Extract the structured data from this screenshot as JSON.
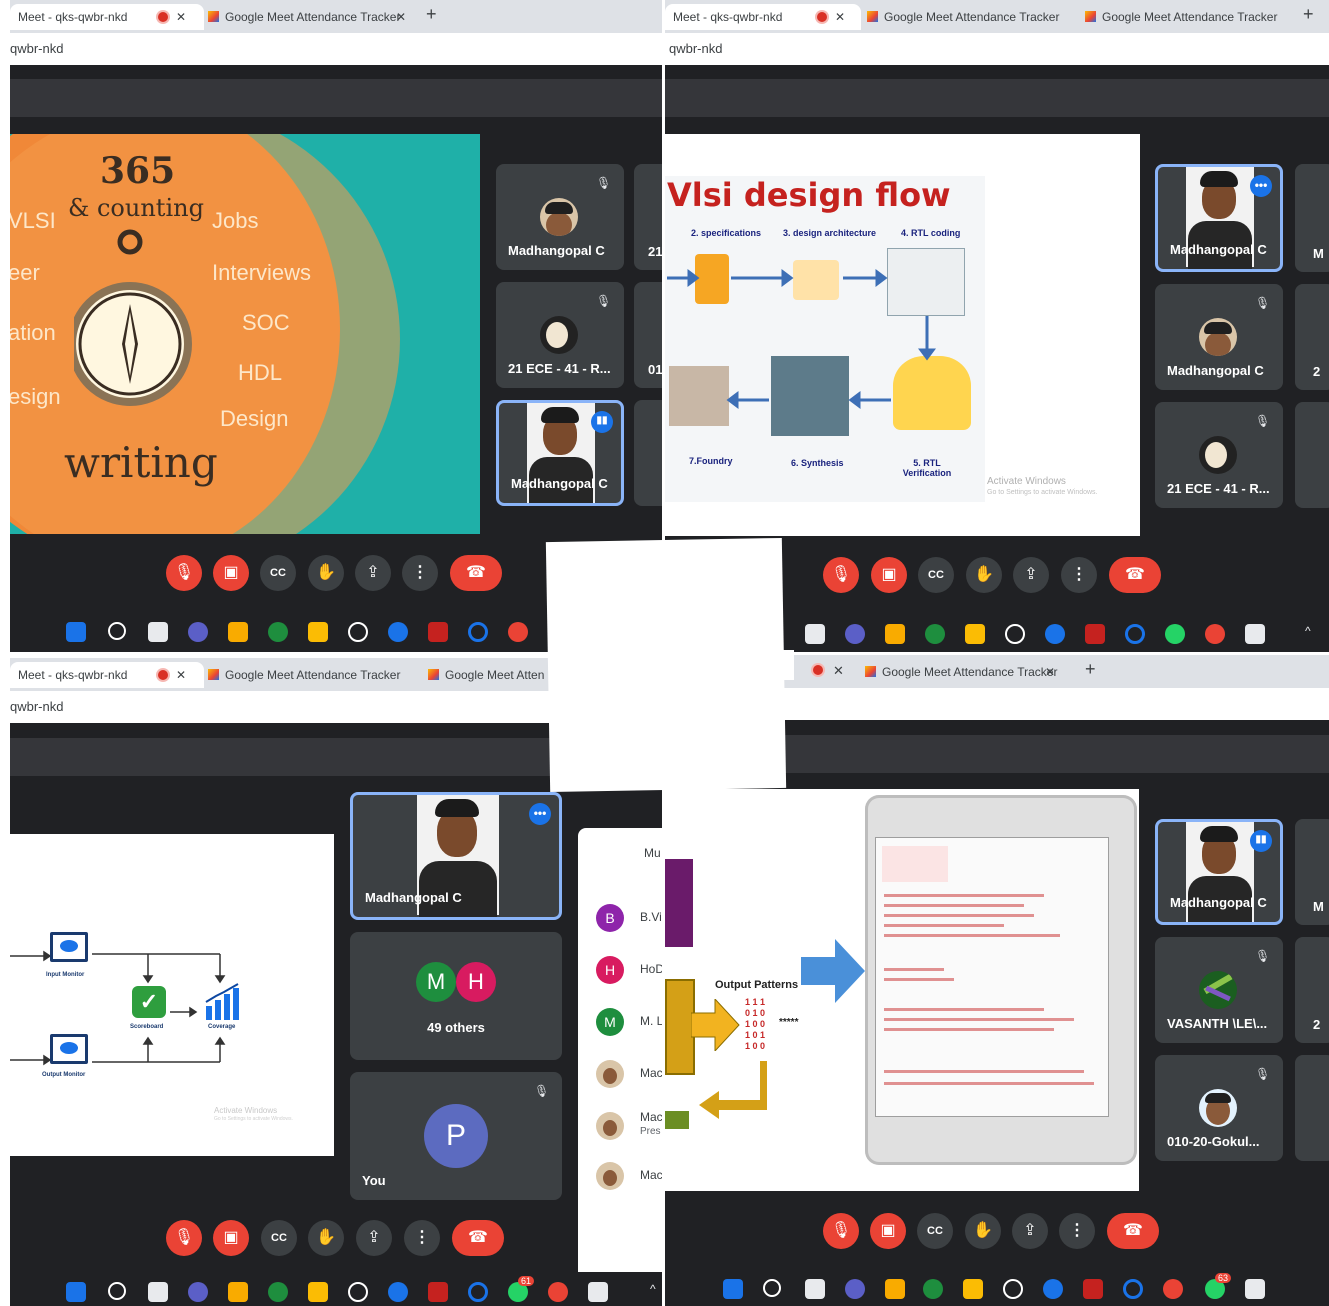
{
  "tabs": {
    "meet_tab": "Meet - qks-qwbr-nkd",
    "attendance_tab": "Google Meet Attendance Tracker",
    "attendance_tab_short": "Google Meet Atten",
    "close": "✕",
    "new_tab": "+"
  },
  "address": "qwbr-nkd",
  "q1": {
    "slide": {
      "number": "365",
      "counting": "& counting",
      "left_words": [
        "VLSI",
        "eer",
        "ation",
        "esign"
      ],
      "right_words": [
        "Jobs",
        "Interviews",
        "SOC",
        "HDL",
        "Design"
      ],
      "bottom": "writing"
    },
    "tiles": [
      {
        "name": "Madhangopal C"
      },
      {
        "name": "21 ECE - 41 - R..."
      },
      {
        "name": "Madhangopal C"
      }
    ],
    "edge_labels": [
      "21",
      "01"
    ]
  },
  "q2": {
    "slide": {
      "title": "Vlsi design flow",
      "steps": [
        "2. specifications",
        "3. design architecture",
        "4. RTL coding",
        "7.Foundry",
        "6. Synthesis",
        "5. RTL Verification"
      ],
      "watermark_title": "Activate Windows",
      "watermark_sub": "Go to Settings to activate Windows."
    },
    "tiles": [
      {
        "name": "Madhangopal C"
      },
      {
        "name": "Madhangopal C"
      },
      {
        "name": "21 ECE - 41 - R..."
      }
    ],
    "edge_labels": [
      "M",
      "2"
    ]
  },
  "q3": {
    "slide": {
      "input_monitor": "Input Monitor",
      "output_monitor": "Output Monitor",
      "scoreboard": "Scoreboard",
      "coverage": "Coverage",
      "watermark_title": "Activate Windows",
      "watermark_sub": "Go to Settings to activate Windows."
    },
    "tiles": [
      {
        "name": "Madhangopal C"
      },
      {
        "name": "49 others",
        "initials": [
          "M",
          "H"
        ]
      },
      {
        "name": "You",
        "initial": "P"
      }
    ],
    "people": [
      {
        "initial": "",
        "label": "Mu"
      },
      {
        "initial": "B",
        "label": "B.Vi",
        "color": "#8e24aa"
      },
      {
        "initial": "H",
        "label": "HoD",
        "color": "#d81b60"
      },
      {
        "initial": "M",
        "label": "M. L",
        "color": "#1e8e3e"
      },
      {
        "initial": "",
        "label": "Mac"
      },
      {
        "initial": "",
        "label": "Mac",
        "sub": "Pres"
      },
      {
        "initial": "",
        "label": "Mac"
      }
    ]
  },
  "q4": {
    "slide": {
      "output_patterns": "Output Patterns",
      "stars": "*****",
      "bits": [
        "1 1 1",
        "0 1 0",
        "1 0 0",
        "1 0 1",
        "1 0 0"
      ]
    },
    "tiles": [
      {
        "name": "Madhangopal C"
      },
      {
        "name": "VASANTH \\LE\\..."
      },
      {
        "name": "010-20-Gokul..."
      }
    ],
    "edge_labels": [
      "M",
      "2"
    ]
  },
  "taskbar": {
    "badge_q3": "61",
    "badge_q4": "63"
  },
  "icons": {
    "mic_off": "mic-off-icon",
    "cam_off": "camera-off-icon",
    "captions": "captions-icon",
    "hand": "raise-hand-icon",
    "present": "present-icon",
    "more": "more-options-icon",
    "end": "end-call-icon"
  },
  "colors": {
    "end_call": "#ea4335",
    "active_border": "#8ab4f8",
    "meet_bg": "#202124",
    "tab_bar": "#dee1e6"
  }
}
